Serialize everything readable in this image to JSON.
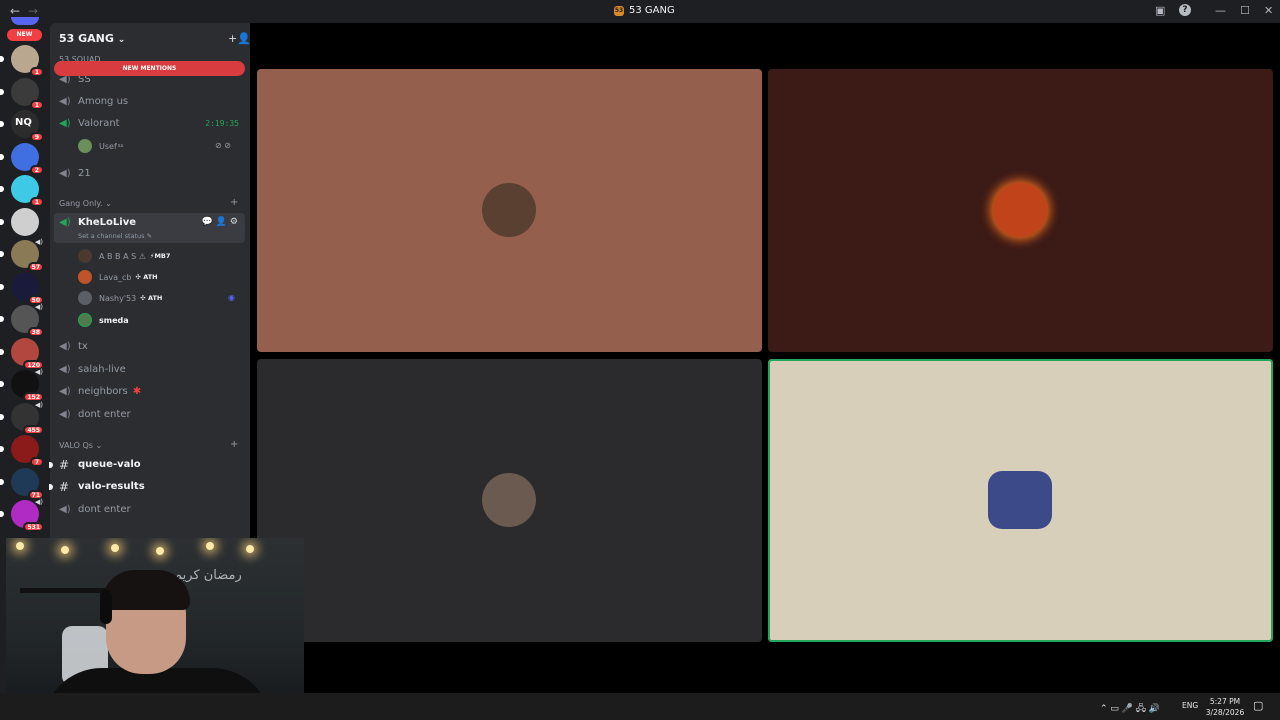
{
  "window": {
    "title": "53 GANG",
    "back_glyph": "←",
    "forward_glyph": "→",
    "inbox_glyph": "▣",
    "help_glyph": "?",
    "minimize_glyph": "—",
    "maximize_glyph": "☐",
    "close_glyph": "✕"
  },
  "rail": {
    "new_label": "NEW",
    "servers": [
      {
        "badge": "1",
        "color": "#b9a78f",
        "spk": ""
      },
      {
        "badge": "1",
        "color": "#3b3b3b",
        "spk": ""
      },
      {
        "badge": "9",
        "color": "#2c2c2c",
        "spk": "",
        "text": "NQ"
      },
      {
        "badge": "2",
        "color": "#3f6fe0",
        "spk": ""
      },
      {
        "badge": "1",
        "color": "#3ec9e6",
        "spk": ""
      },
      {
        "badge": "",
        "color": "#cfcfcf",
        "spk": ""
      },
      {
        "badge": "57",
        "color": "#8a7a55",
        "spk": "◀)"
      },
      {
        "badge": "50",
        "color": "#1a1a3a",
        "spk": ""
      },
      {
        "badge": "38",
        "color": "#555555",
        "spk": "◀)"
      },
      {
        "badge": "120",
        "color": "#b1473f",
        "spk": ""
      },
      {
        "badge": "152",
        "color": "#111111",
        "spk": "◀)"
      },
      {
        "badge": "455",
        "color": "#333333",
        "spk": "◀)"
      },
      {
        "badge": "7",
        "color": "#8b1a1a",
        "spk": ""
      },
      {
        "badge": "71",
        "color": "#1f3a56",
        "spk": ""
      },
      {
        "badge": "531",
        "color": "#b02bc4",
        "spk": "◀)"
      }
    ]
  },
  "sidebar": {
    "guild_name": "53 GANG",
    "chevron": "⌄",
    "invite_glyph": "+👤",
    "new_mentions": "NEW MENTIONS",
    "cat1": "53 SQUAD",
    "cat2": "Gang Only.",
    "cat3": "VALO Qs",
    "add_glyph": "+",
    "channels": {
      "ss": "SS",
      "among": "Among us",
      "valorant": "Valorant",
      "valorant_timer": "2:19:35",
      "ch21": "21",
      "khelo": "KheLoLive",
      "khelo_status": "Set a channel status ✎",
      "khelo_tools": "💬👤⚙",
      "tx": "tx",
      "salah": "salah-live",
      "neighbors": "neighbors",
      "neighbors_mark": "✱",
      "dont1": "dont enter",
      "queue": "queue-valo",
      "results": "valo-results",
      "dont2": "dont enter"
    },
    "speaker_glyph": "◀)",
    "hash_glyph": "#",
    "users": {
      "usef": "Usef",
      "usef_tag": "ꜱᴀ",
      "usef_icons": "⊘ ⊘",
      "abbas": "A B B A S ⚠",
      "abbas_tag": "⚡MB7",
      "lava": "Lava_cb",
      "lava_tag": "✣ ATH",
      "nashy": "Nashy'53",
      "nashy_tag": "✣ ATH",
      "nashy_icon": "◉",
      "smeda": "smeda"
    }
  },
  "stage": {
    "tiles": [
      {
        "bg": "#94604d",
        "avatar": "#5a4030"
      },
      {
        "bg": "#3c1a16",
        "avatar": "#c1431a"
      },
      {
        "bg": "#2b2b2d",
        "avatar": "#6a5a50"
      },
      {
        "bg": "#d8cfbb",
        "avatar": "#3c4a8a"
      }
    ]
  },
  "taskbar": {
    "tray_glyphs": "⌃  ▭  🎤  🖧  🔊",
    "lang": "ENG",
    "time": "5:27 PM",
    "date": "3/28/2026",
    "notif_glyph": "▢"
  },
  "webcam": {
    "sign_text": "رمضان كريم"
  },
  "colors": {
    "accent_green": "#23a55a",
    "mention_red": "#f23f43"
  }
}
